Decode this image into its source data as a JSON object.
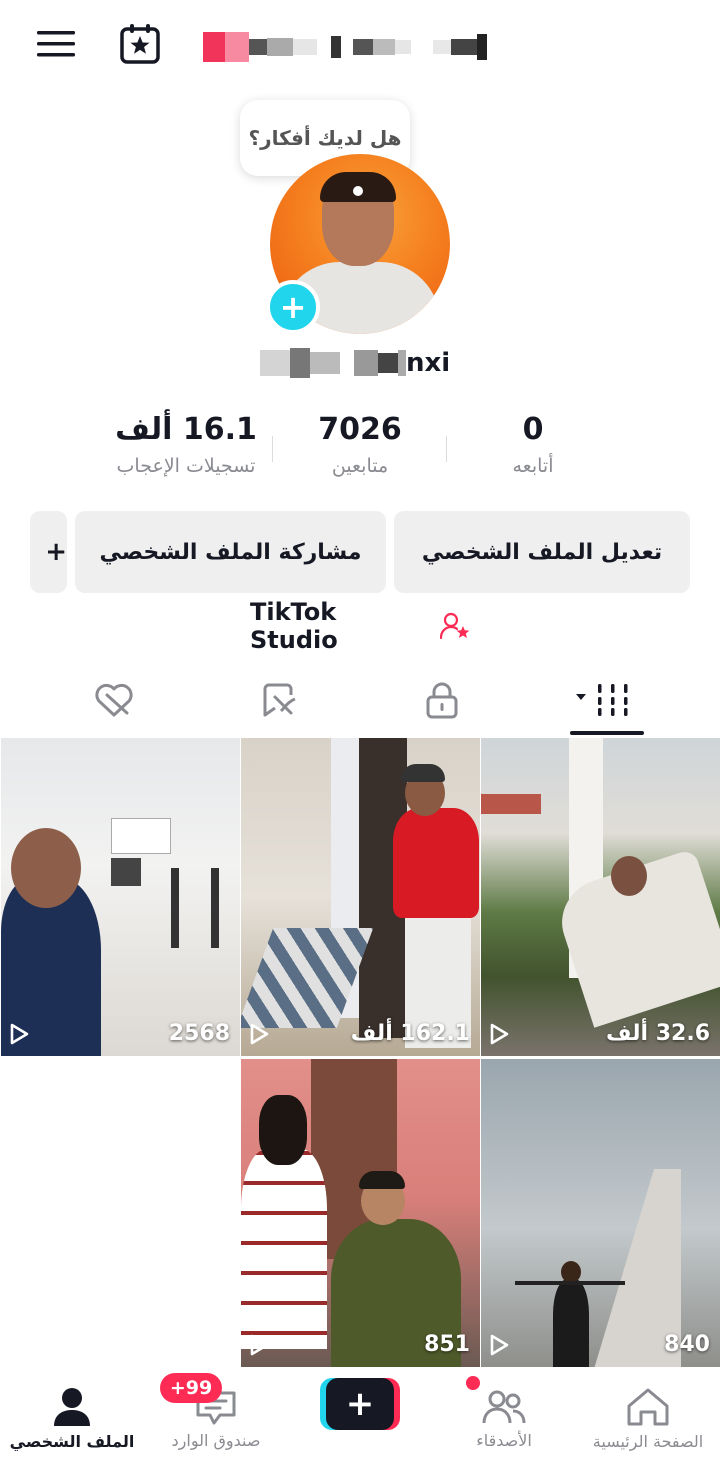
{
  "header": {
    "menu_icon": "hamburger-menu-icon",
    "calendar_icon": "calendar-star-icon",
    "blurred_title_colors": [
      "#f0345a",
      "#e0e0e0",
      "#333333"
    ]
  },
  "bubble": {
    "text": "هل لديك أفكار؟"
  },
  "profile": {
    "username_suffix": "nxi"
  },
  "stats": [
    {
      "value": "0",
      "label": "أتابعه"
    },
    {
      "value": "7026",
      "label": "متابعين"
    },
    {
      "value": "16.1 ألف",
      "label": "تسجيلات الإعجاب"
    }
  ],
  "buttons": {
    "edit_profile": "تعديل الملف الشخصي",
    "share_profile": "مشاركة الملف الشخصي",
    "add_friend": "+"
  },
  "studio": {
    "label": "TikTok Studio"
  },
  "tabs": [
    {
      "icon": "videos-grid-icon",
      "active": true
    },
    {
      "icon": "lock-icon",
      "active": false
    },
    {
      "icon": "reposts-icon",
      "active": false
    },
    {
      "icon": "liked-heart-icon",
      "active": false
    }
  ],
  "videos": [
    {
      "views": "32.6 ألف"
    },
    {
      "views": "162.1 ألف"
    },
    {
      "views": "2568"
    },
    {
      "views": "840"
    },
    {
      "views": "851"
    }
  ],
  "nav": {
    "home": "الصفحة الرئيسية",
    "friends": "الأصدقاء",
    "inbox": "صندوق الوارد",
    "inbox_badge": "+99",
    "profile": "الملف الشخصي",
    "create": "+"
  },
  "colors": {
    "accent": "#fe2c55",
    "cyan": "#20d5ec",
    "text": "#161823",
    "muted": "#8a8b91"
  }
}
